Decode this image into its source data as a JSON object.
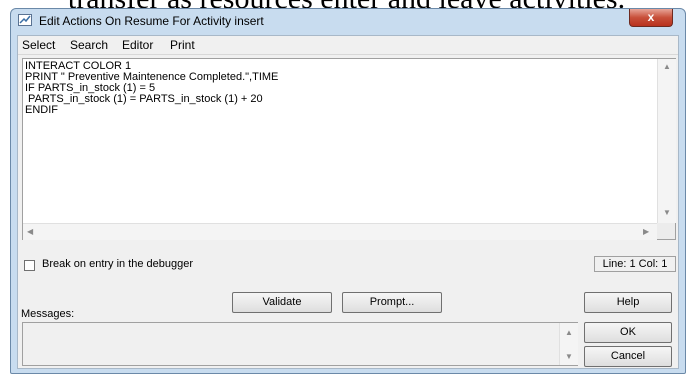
{
  "background_text": "transfer as resources enter and leave activities.",
  "window": {
    "title": "Edit Actions On Resume For Activity insert",
    "close_glyph": "x"
  },
  "menu": [
    {
      "label": "Select"
    },
    {
      "label": "Search"
    },
    {
      "label": "Editor"
    },
    {
      "label": "Print"
    }
  ],
  "editor": {
    "code": "INTERACT COLOR 1\nPRINT \" Preventive Maintenence Completed.\",TIME\nIF PARTS_in_stock (1) = 5\n PARTS_in_stock (1) = PARTS_in_stock (1) + 20\nENDIF"
  },
  "debugger": {
    "label": "Break on entry in the debugger",
    "checked": false
  },
  "status": {
    "position": "Line: 1 Col: 1"
  },
  "buttons": {
    "validate": "Validate",
    "prompt": "Prompt...",
    "help": "Help",
    "ok": "OK",
    "cancel": "Cancel"
  },
  "messages": {
    "label": "Messages:",
    "content": ""
  },
  "icons": {
    "app": "edit-app-icon",
    "close": "close-icon"
  },
  "colors": {
    "window_frame": "#c8dcef",
    "close_button": "#c8503a"
  }
}
